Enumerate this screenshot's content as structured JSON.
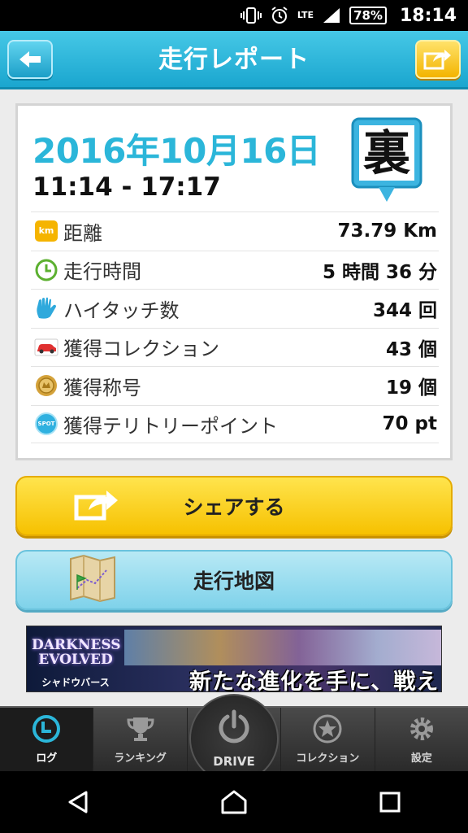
{
  "status_bar": {
    "network": "LTE",
    "battery": "78%",
    "time": "18:14"
  },
  "header": {
    "title": "走行レポート"
  },
  "report": {
    "date": "2016年10月16日",
    "time_range": "11:14 - 17:17",
    "badge_char": "裏",
    "stats": [
      {
        "icon": "km-icon",
        "icon_text": "km",
        "label": "距離",
        "value": "73.79 Km"
      },
      {
        "icon": "clock-icon",
        "label": "走行時間",
        "value": "5 時間 36 分"
      },
      {
        "icon": "hi-touch-icon",
        "label": "ハイタッチ数",
        "value": "344 回"
      },
      {
        "icon": "car-icon",
        "label": "獲得コレクション",
        "value": "43 個"
      },
      {
        "icon": "title-medal-icon",
        "label": "獲得称号",
        "value": "19 個"
      },
      {
        "icon": "spot-icon",
        "icon_text": "SPOT",
        "label": "獲得テリトリーポイント",
        "value": "70 pt"
      }
    ]
  },
  "buttons": {
    "share_label": "シェアする",
    "map_label": "走行地図"
  },
  "ad": {
    "logo": "DARKNESS EVOLVED",
    "logo_sub": "シャドウバース",
    "copy": "新たな進化を手に、戦え"
  },
  "tabs": [
    {
      "label": "ログ",
      "icon": "log-clock-icon",
      "active": true
    },
    {
      "label": "ランキング",
      "icon": "trophy-icon",
      "active": false
    },
    {
      "label": "DRIVE",
      "icon": "power-icon",
      "active": false
    },
    {
      "label": "コレクション",
      "icon": "star-icon",
      "active": false
    },
    {
      "label": "設定",
      "icon": "gear-icon",
      "active": false
    }
  ],
  "colors": {
    "accent": "#2bb6d9",
    "header": "#1aa6cf",
    "share_button": "#f6c100",
    "map_button": "#7fd2ea",
    "active_tab_icon": "#2bb6d9"
  }
}
